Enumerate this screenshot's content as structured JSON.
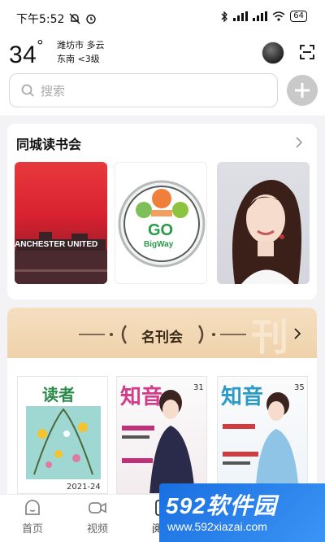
{
  "status_bar": {
    "time": "下午5:52",
    "battery": "64"
  },
  "header": {
    "temperature": "34",
    "degree_symbol": "°",
    "city_weather": "潍坊市 多云",
    "wind": "东南 <3级"
  },
  "search": {
    "placeholder": "搜索"
  },
  "book_club": {
    "title": "同城读书会",
    "thumb1_text": "ANCHESTER UNITED",
    "thumb2_text": "GO",
    "thumb2_sub": "BigWay"
  },
  "magazines": {
    "title": "名刊会",
    "items": [
      {
        "name": "读者",
        "issue": "2021-24"
      },
      {
        "name": "知音",
        "issue": "31"
      },
      {
        "name": "知音",
        "issue": "35"
      }
    ]
  },
  "bottom_nav": {
    "items": [
      {
        "label": "首页"
      },
      {
        "label": "视频"
      },
      {
        "label": "阅读"
      }
    ]
  },
  "watermark": {
    "brand": "592软件园",
    "url": "www.592xiazai.com"
  },
  "colors": {
    "accent": "#3b94f5",
    "band": "#f1d8b4"
  }
}
